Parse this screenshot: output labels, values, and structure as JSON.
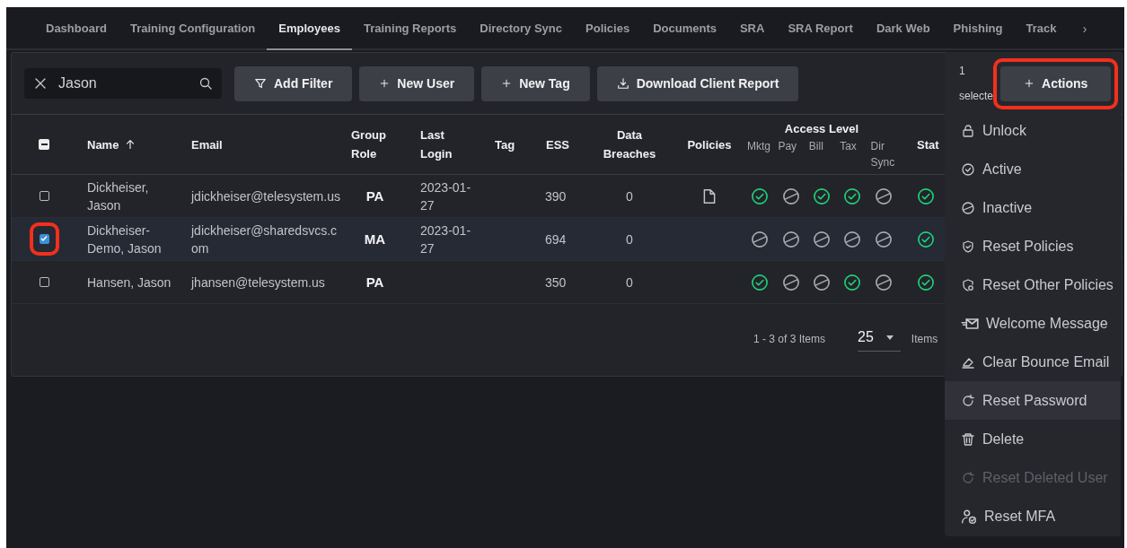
{
  "tabs": [
    {
      "label": "Dashboard",
      "selected": false
    },
    {
      "label": "Training Configuration",
      "selected": false
    },
    {
      "label": "Employees",
      "selected": true
    },
    {
      "label": "Training Reports",
      "selected": false
    },
    {
      "label": "Directory Sync",
      "selected": false
    },
    {
      "label": "Policies",
      "selected": false
    },
    {
      "label": "Documents",
      "selected": false
    },
    {
      "label": "SRA",
      "selected": false
    },
    {
      "label": "SRA Report",
      "selected": false
    },
    {
      "label": "Dark Web",
      "selected": false
    },
    {
      "label": "Phishing",
      "selected": false
    },
    {
      "label": "Track",
      "selected": false
    }
  ],
  "tabs_more": "›",
  "search": {
    "value": "Jason"
  },
  "toolbar_buttons": [
    {
      "label": "Add Filter",
      "kind": "filter"
    },
    {
      "label": "New User",
      "kind": "plus"
    },
    {
      "label": "New Tag",
      "kind": "plus"
    },
    {
      "label": "Download Client Report",
      "kind": "download"
    }
  ],
  "table": {
    "select_all_indeterminate": true,
    "columns": [
      {
        "label": "Name",
        "sorted": true
      },
      {
        "label": "Email",
        "sorted": false
      },
      {
        "label": "Group Role",
        "sorted": false
      },
      {
        "label": "Last Login",
        "sorted": false
      },
      {
        "label": "Tag",
        "sorted": false
      },
      {
        "label": "ESS",
        "sorted": false
      },
      {
        "label": "Data Breaches",
        "sorted": false
      },
      {
        "label": "Policies",
        "sorted": false
      }
    ],
    "access_level": {
      "title": "Access Level",
      "columns": [
        "Mktg",
        "Pay",
        "Bill",
        "Tax",
        "Dir Sync"
      ]
    },
    "status_column": "Stat",
    "rows": [
      {
        "name": "Dickheiser, Jason",
        "email": "jdickheiser@telesystem.us",
        "group_role": "PA",
        "last_login": "2023-01-27",
        "ess": "390",
        "data_breaches": "0",
        "has_policy": true,
        "access": [
          true,
          false,
          true,
          true,
          false
        ],
        "status_active": true,
        "selected": false,
        "highlighted": false
      },
      {
        "name": "Dickheiser-Demo, Jason",
        "email": "jdickheiser@sharedsvcs.com",
        "group_role": "MA",
        "last_login": "2023-01-27",
        "ess": "694",
        "data_breaches": "0",
        "has_policy": false,
        "access": [
          false,
          false,
          false,
          false,
          false
        ],
        "status_active": true,
        "selected": true,
        "highlighted": true
      },
      {
        "name": "Hansen, Jason",
        "email": "jhansen@telesystem.us",
        "group_role": "PA",
        "last_login": "",
        "ess": "350",
        "data_breaches": "0",
        "has_policy": false,
        "access": [
          true,
          false,
          false,
          true,
          false
        ],
        "status_active": true,
        "selected": false,
        "highlighted": false
      }
    ]
  },
  "pagination": {
    "range": "1 - 3 of 3 Items",
    "page_size": "25",
    "page_size_label": "Items"
  },
  "actions_menu": {
    "selection_count": "1 selecte",
    "button": {
      "label": "Actions",
      "highlighted": true
    },
    "items": [
      {
        "label": "Unlock",
        "kind": "lock",
        "selected": false,
        "disabled": false
      },
      {
        "label": "Active",
        "kind": "check",
        "selected": false,
        "disabled": false
      },
      {
        "label": "Inactive",
        "kind": "slash",
        "selected": false,
        "disabled": false
      },
      {
        "label": "Reset Policies",
        "kind": "shield",
        "selected": false,
        "disabled": false
      },
      {
        "label": "Reset Other Policies",
        "kind": "shield-gear",
        "selected": false,
        "disabled": false
      },
      {
        "label": "Welcome Message",
        "kind": "envelope",
        "selected": false,
        "disabled": false
      },
      {
        "label": "Clear Bounce Email",
        "kind": "eraser",
        "selected": false,
        "disabled": false
      },
      {
        "label": "Reset Password",
        "kind": "refresh",
        "selected": true,
        "disabled": false
      },
      {
        "label": "Delete",
        "kind": "trash",
        "selected": false,
        "disabled": false
      },
      {
        "label": "Reset Deleted User",
        "kind": "refresh",
        "selected": false,
        "disabled": true
      },
      {
        "label": "Reset MFA",
        "kind": "user-check",
        "selected": false,
        "disabled": false
      }
    ]
  }
}
